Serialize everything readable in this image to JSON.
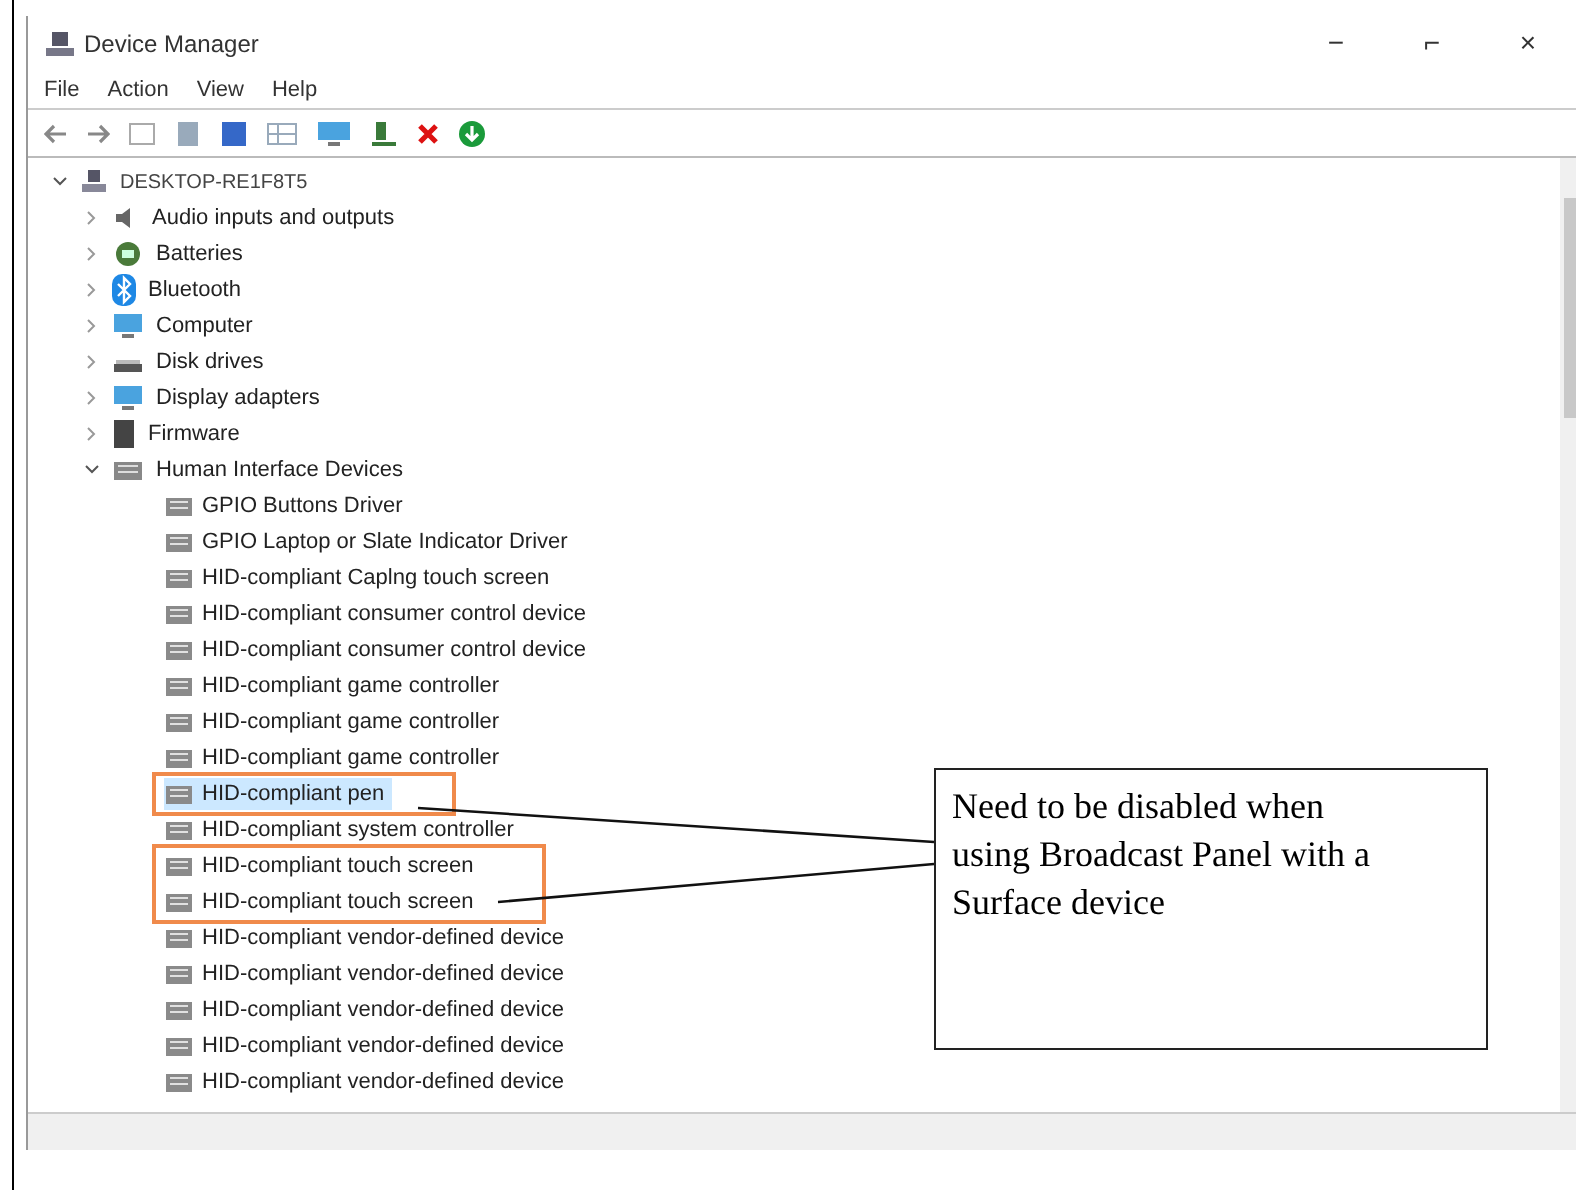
{
  "window": {
    "title": "Device Manager",
    "controls": [
      "−",
      "⌐",
      "×"
    ]
  },
  "menu": [
    "File",
    "Action",
    "View",
    "Help"
  ],
  "tree": {
    "label": "DESKTOP-RE1F8T5",
    "expanded": true,
    "children": [
      {
        "label": "Audio inputs and outputs",
        "kind": "audio",
        "expanded": false
      },
      {
        "label": "Batteries",
        "kind": "battery",
        "expanded": false
      },
      {
        "label": "Bluetooth",
        "kind": "bluetooth",
        "expanded": false
      },
      {
        "label": "Computer",
        "kind": "monitor",
        "expanded": false
      },
      {
        "label": "Disk drives",
        "kind": "disk",
        "expanded": false
      },
      {
        "label": "Display adapters",
        "kind": "monitor",
        "expanded": false
      },
      {
        "label": "Firmware",
        "kind": "chip",
        "expanded": false
      },
      {
        "label": "Human Interface Devices",
        "kind": "hid",
        "expanded": true,
        "children": [
          {
            "label": "GPIO Buttons Driver",
            "selected": false,
            "marked": false
          },
          {
            "label": "GPIO Laptop or Slate Indicator Driver",
            "selected": false,
            "marked": false
          },
          {
            "label": "HID-compliant Caplng touch screen",
            "selected": false,
            "marked": false
          },
          {
            "label": "HID-compliant consumer control device",
            "selected": false,
            "marked": false
          },
          {
            "label": "HID-compliant consumer control device",
            "selected": false,
            "marked": false
          },
          {
            "label": "HID-compliant game controller",
            "selected": false,
            "marked": false
          },
          {
            "label": "HID-compliant game controller",
            "selected": false,
            "marked": false
          },
          {
            "label": "HID-compliant game controller",
            "selected": false,
            "marked": false
          },
          {
            "label": "HID-compliant pen",
            "selected": true,
            "marked": true
          },
          {
            "label": "HID-compliant system controller",
            "selected": false,
            "marked": false
          },
          {
            "label": "HID-compliant touch screen",
            "selected": false,
            "marked": true
          },
          {
            "label": "HID-compliant touch screen",
            "selected": false,
            "marked": true
          },
          {
            "label": "HID-compliant vendor-defined device",
            "selected": false,
            "marked": false
          },
          {
            "label": "HID-compliant vendor-defined device",
            "selected": false,
            "marked": false
          },
          {
            "label": "HID-compliant vendor-defined device",
            "selected": false,
            "marked": false
          },
          {
            "label": "HID-compliant vendor-defined device",
            "selected": false,
            "marked": false
          },
          {
            "label": "HID-compliant vendor-defined device",
            "selected": false,
            "marked": false
          }
        ]
      }
    ]
  },
  "callout": {
    "text": "Need to be disabled when using Broadcast Panel with a Surface device"
  }
}
